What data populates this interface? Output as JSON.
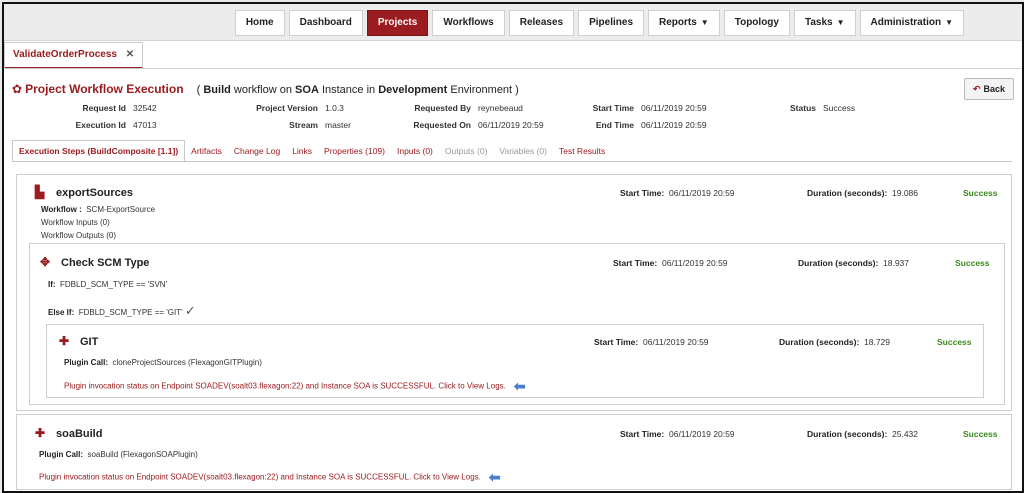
{
  "nav": {
    "items": [
      {
        "label": "Home"
      },
      {
        "label": "Dashboard"
      },
      {
        "label": "Projects"
      },
      {
        "label": "Workflows"
      },
      {
        "label": "Releases"
      },
      {
        "label": "Pipelines"
      },
      {
        "label": "Reports"
      },
      {
        "label": "Topology"
      },
      {
        "label": "Tasks"
      },
      {
        "label": "Administration"
      }
    ],
    "active": "Projects"
  },
  "doc_tab": {
    "label": "ValidateOrderProcess",
    "close": "✕"
  },
  "header": {
    "title": "Project Workflow Execution",
    "subtitle_open": "( ",
    "subtitle_build": "Build",
    "subtitle_mid1": " workflow on ",
    "subtitle_soa": "SOA",
    "subtitle_mid2": " Instance in ",
    "subtitle_env": "Development",
    "subtitle_end": " Environment )",
    "back_label": "Back"
  },
  "meta": {
    "request_id_label": "Request Id",
    "request_id": "32542",
    "execution_id_label": "Execution Id",
    "execution_id": "47013",
    "project_version_label": "Project Version",
    "project_version": "1.0.3",
    "stream_label": "Stream",
    "stream": "master",
    "requested_by_label": "Requested By",
    "requested_by": "reynebeaud",
    "requested_on_label": "Requested On",
    "requested_on": "06/11/2019 20:59",
    "start_time_label": "Start Time",
    "start_time": "06/11/2019 20:59",
    "end_time_label": "End Time",
    "end_time": "06/11/2019 20:59",
    "status_label": "Status",
    "status": "Success"
  },
  "tabs": [
    {
      "label": "Execution Steps (BuildComposite [1.1])"
    },
    {
      "label": "Artifacts"
    },
    {
      "label": "Change Log"
    },
    {
      "label": "Links"
    },
    {
      "label": "Properties (109)"
    },
    {
      "label": "Inputs (0)"
    },
    {
      "label": "Outputs (0)"
    },
    {
      "label": "Variables (0)"
    },
    {
      "label": "Test Results"
    }
  ],
  "labels": {
    "start_time": "Start Time:",
    "duration": "Duration (seconds):",
    "workflow": "Workflow :",
    "if": "If:",
    "else_if": "Else If:",
    "plugin_call": "Plugin Call:"
  },
  "steps": {
    "export": {
      "name": "exportSources",
      "start": "06/11/2019 20:59",
      "duration": "19.086",
      "status": "Success",
      "workflow": "SCM-ExportSource",
      "inputs": "Workflow Inputs (0)",
      "outputs": "Workflow Outputs (0)"
    },
    "check": {
      "name": "Check SCM Type",
      "start": "06/11/2019 20:59",
      "duration": "18.937",
      "status": "Success",
      "if_cond": "FDBLD_SCM_TYPE == 'SVN'",
      "else_if_cond": "FDBLD_SCM_TYPE == 'GIT'",
      "check_mark": "✓"
    },
    "git": {
      "name": "GIT",
      "start": "06/11/2019 20:59",
      "duration": "18.729",
      "status": "Success",
      "plugin_call": "cloneProjectSources (FlexagonGITPlugin)",
      "message": "Plugin invocation status on Endpoint SOADEV(soalt03.flexagon:22) and Instance SOA is SUCCESSFUL. Click to View Logs."
    },
    "soa": {
      "name": "soaBuild",
      "start": "06/11/2019 20:59",
      "duration": "25.432",
      "status": "Success",
      "plugin_call": "soaBuild (FlexagonSOAPlugin)",
      "message": "Plugin invocation status on Endpoint SOADEV(soalt03.flexagon:22) and Instance SOA is SUCCESSFUL. Click to View Logs."
    }
  },
  "colors": {
    "brand": "#9b1c20",
    "success": "#3a8a1c",
    "arrow": "#4a7fd0"
  }
}
